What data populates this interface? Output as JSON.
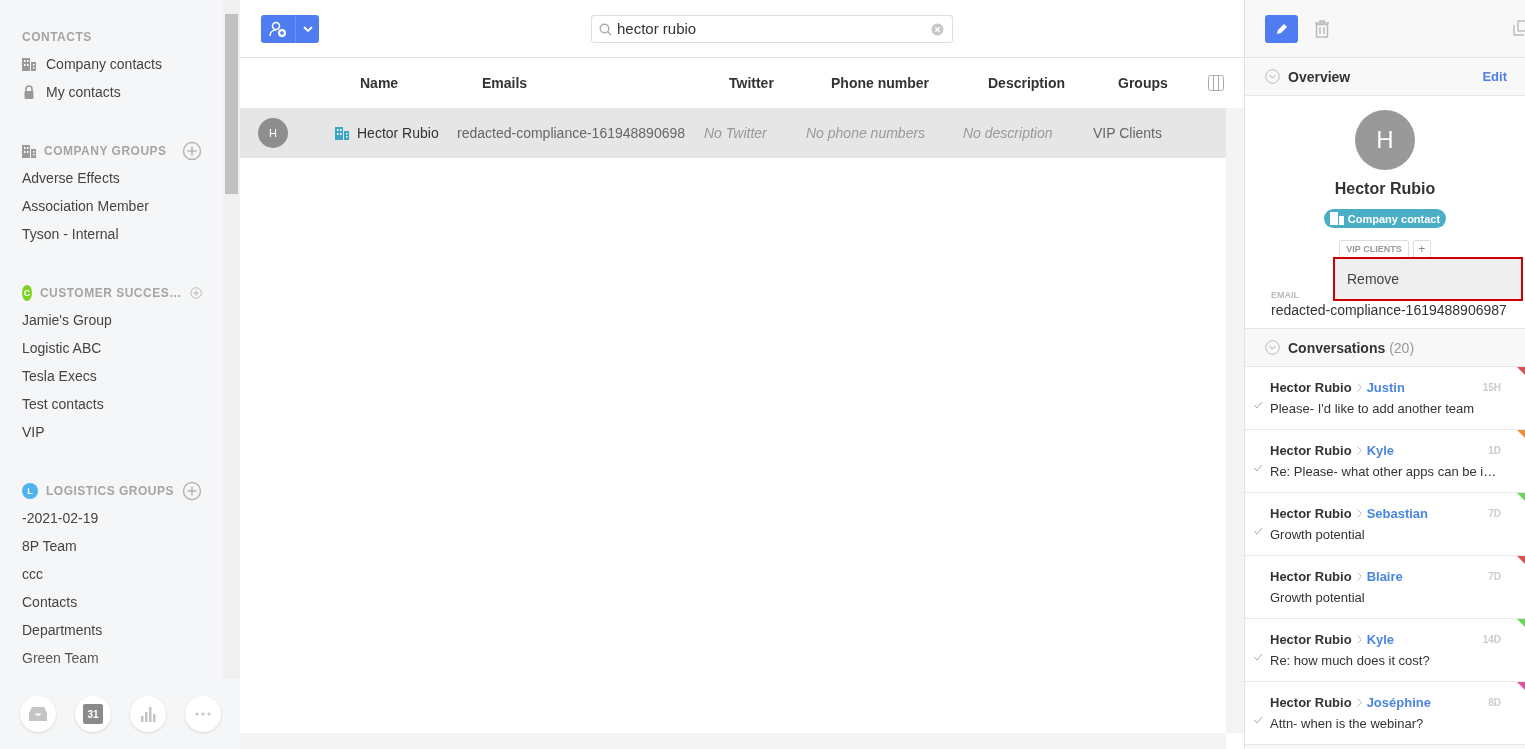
{
  "sidebar": {
    "sections": [
      {
        "title": "CONTACTS",
        "kind": "plain",
        "items": [
          {
            "label": "Company contacts"
          },
          {
            "label": "My contacts"
          }
        ]
      },
      {
        "title": "COMPANY GROUPS",
        "kind": "company",
        "items": [
          {
            "label": "Adverse Effects"
          },
          {
            "label": "Association Member"
          },
          {
            "label": "Tyson - Internal"
          }
        ]
      },
      {
        "title": "CUSTOMER SUCCES…",
        "kind": "letter",
        "badge": "C",
        "color": "#7ed321",
        "items": [
          {
            "label": "Jamie's Group"
          },
          {
            "label": "Logistic ABC"
          },
          {
            "label": "Tesla Execs"
          },
          {
            "label": "Test contacts"
          },
          {
            "label": "VIP"
          }
        ]
      },
      {
        "title": "LOGISTICS GROUPS",
        "kind": "letter",
        "badge": "L",
        "color": "#4fb3f0",
        "items": [
          {
            "label": "-2021-02-19"
          },
          {
            "label": "8P Team"
          },
          {
            "label": "ccc"
          },
          {
            "label": "Contacts"
          },
          {
            "label": "Departments"
          },
          {
            "label": "Green Team"
          }
        ]
      }
    ],
    "calendar_day": "31"
  },
  "search": {
    "value": "hector rubio"
  },
  "table": {
    "columns": [
      "Name",
      "Emails",
      "Twitter",
      "Phone number",
      "Description",
      "Groups"
    ],
    "rows": [
      {
        "selected": true,
        "avatar": "H",
        "name": "Hector Rubio",
        "email": "redacted-compliance-161948890698",
        "twitter": "No Twitter",
        "phone": "No phone numbers",
        "description": "No description",
        "groups": "VIP Clients"
      }
    ]
  },
  "detail": {
    "overview_title": "Overview",
    "edit": "Edit",
    "avatar": "H",
    "name": "Hector Rubio",
    "tag": "Company contact",
    "group": "VIP CLIENTS",
    "add": "+",
    "menu": [
      "Remove"
    ],
    "email_label": "EMAIL",
    "email": "redacted-compliance-1619488906987",
    "conversations_title": "Conversations",
    "conversations_count": "(20)",
    "conversations": [
      {
        "from": "Hector Rubio",
        "to": "Justin",
        "time": "15H",
        "text": "Please- I'd like to add another team",
        "checked": true,
        "color": "#d9534f"
      },
      {
        "from": "Hector Rubio",
        "to": "Kyle",
        "time": "1D",
        "text": "Re: Please- what other apps can be i…",
        "checked": true,
        "color": "#e8913a"
      },
      {
        "from": "Hector Rubio",
        "to": "Sebastian",
        "time": "7D",
        "text": "Growth potential",
        "checked": true,
        "color": "#6cd35b"
      },
      {
        "from": "Hector Rubio",
        "to": "Blaire",
        "time": "7D",
        "text": "Growth potential",
        "checked": false,
        "color": "#d9534f"
      },
      {
        "from": "Hector Rubio",
        "to": "Kyle",
        "time": "14D",
        "text": "Re: how much does it cost?",
        "checked": true,
        "color": "#6cd35b"
      },
      {
        "from": "Hector Rubio",
        "to": "Joséphine",
        "time": "8D",
        "text": "Attn- when is the webinar?",
        "checked": true,
        "color": "#d9539f"
      }
    ]
  }
}
